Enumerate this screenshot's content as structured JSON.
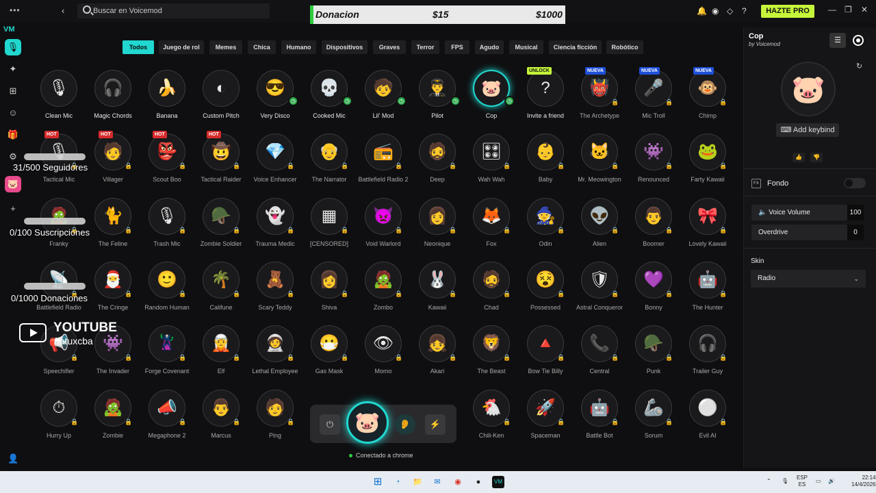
{
  "search": {
    "placeholder": "Buscar en Voicemod"
  },
  "donation": {
    "label": "Donacion",
    "current": "$15",
    "goal": "$1000"
  },
  "header": {
    "upgrade_label": "HAZTE PRO"
  },
  "categories": [
    "Todos",
    "Juego de rol",
    "Memes",
    "Chica",
    "Humano",
    "Dispositivos",
    "Graves",
    "Terror",
    "FPS",
    "Agudo",
    "Musical",
    "Ciencia ficción",
    "Robótico"
  ],
  "voices": [
    {
      "name": "Clean Mic",
      "icon": "🎙",
      "free": true,
      "badge": ""
    },
    {
      "name": "Magic Chords",
      "icon": "🎧",
      "free": true,
      "badge": ""
    },
    {
      "name": "Banana",
      "icon": "🍌",
      "free": true,
      "badge": ""
    },
    {
      "name": "Custom Pitch",
      "icon": "◐",
      "free": true,
      "badge": ""
    },
    {
      "name": "Very Disco",
      "icon": "😎",
      "free": true,
      "badge": "",
      "clock": true
    },
    {
      "name": "Cooked Mic",
      "icon": "💀",
      "free": true,
      "badge": "",
      "clock": true
    },
    {
      "name": "Lil' Mod",
      "icon": "🧒",
      "free": true,
      "badge": "",
      "clock": true
    },
    {
      "name": "Pilot",
      "icon": "👨‍✈️",
      "free": true,
      "badge": "",
      "clock": true
    },
    {
      "name": "Cop",
      "icon": "🐷",
      "free": true,
      "badge": "",
      "clock": true,
      "selected": true
    },
    {
      "name": "Invite a friend",
      "icon": "?",
      "free": true,
      "badge": "UNLOCK"
    },
    {
      "name": "The Archetype",
      "icon": "👹",
      "badge": "NUEVA"
    },
    {
      "name": "Mic Troll",
      "icon": "🎤",
      "badge": "NUEVA"
    },
    {
      "name": "Chimp",
      "icon": "🐵",
      "badge": "NUEVA"
    },
    {
      "name": "Tactical Mic",
      "icon": "🎙",
      "badge": "HOT"
    },
    {
      "name": "Villager",
      "icon": "🧑",
      "badge": "HOT"
    },
    {
      "name": "Scout Boo",
      "icon": "👺",
      "badge": "HOT"
    },
    {
      "name": "Tactical Raider",
      "icon": "🤠",
      "badge": "HOT"
    },
    {
      "name": "Voice Enhancer",
      "icon": "💎",
      "badge": ""
    },
    {
      "name": "The Narrator",
      "icon": "👴",
      "badge": ""
    },
    {
      "name": "Battlefield Radio 2",
      "icon": "📻",
      "badge": ""
    },
    {
      "name": "Deep",
      "icon": "🧔",
      "badge": ""
    },
    {
      "name": "Wah Wah",
      "icon": "🎛",
      "badge": ""
    },
    {
      "name": "Baby",
      "icon": "👶",
      "badge": ""
    },
    {
      "name": "Mr. Meowington",
      "icon": "🐱",
      "badge": ""
    },
    {
      "name": "Renounced",
      "icon": "👾",
      "badge": ""
    },
    {
      "name": "Farty Kawaii",
      "icon": "🐸",
      "badge": ""
    },
    {
      "name": "Franky",
      "icon": "🧟",
      "badge": ""
    },
    {
      "name": "The Feline",
      "icon": "🐈",
      "badge": ""
    },
    {
      "name": "Trash Mic",
      "icon": "🎙",
      "badge": ""
    },
    {
      "name": "Zombie Soldier",
      "icon": "🪖",
      "badge": ""
    },
    {
      "name": "Trauma Medic",
      "icon": "👻",
      "badge": ""
    },
    {
      "name": "[CENSORED]",
      "icon": "▦",
      "badge": ""
    },
    {
      "name": "Void Warlord",
      "icon": "👿",
      "badge": ""
    },
    {
      "name": "Neonique",
      "icon": "👩",
      "badge": ""
    },
    {
      "name": "Fox",
      "icon": "🦊",
      "badge": ""
    },
    {
      "name": "Odin",
      "icon": "🧙",
      "badge": ""
    },
    {
      "name": "Alien",
      "icon": "👽",
      "badge": ""
    },
    {
      "name": "Boomer",
      "icon": "👨",
      "badge": ""
    },
    {
      "name": "Lovely Kawaii",
      "icon": "🎀",
      "badge": ""
    },
    {
      "name": "Battlefield Radio",
      "icon": "📡",
      "badge": ""
    },
    {
      "name": "The Cringe",
      "icon": "🎅",
      "badge": ""
    },
    {
      "name": "Random Human",
      "icon": "🙂",
      "badge": ""
    },
    {
      "name": "Califune",
      "icon": "🌴",
      "badge": ""
    },
    {
      "name": "Scary Teddy",
      "icon": "🧸",
      "badge": ""
    },
    {
      "name": "Shiva",
      "icon": "👩",
      "badge": ""
    },
    {
      "name": "Zombo",
      "icon": "🧟",
      "badge": ""
    },
    {
      "name": "Kawaii",
      "icon": "🐰",
      "badge": ""
    },
    {
      "name": "Chad",
      "icon": "🧔",
      "badge": ""
    },
    {
      "name": "Possessed",
      "icon": "😵",
      "badge": ""
    },
    {
      "name": "Astral Conqueror",
      "icon": "🛡",
      "badge": ""
    },
    {
      "name": "Bonny",
      "icon": "💜",
      "badge": ""
    },
    {
      "name": "The Hunter",
      "icon": "🤖",
      "badge": ""
    },
    {
      "name": "Speechifier",
      "icon": "📢",
      "badge": ""
    },
    {
      "name": "The Invader",
      "icon": "👾",
      "badge": ""
    },
    {
      "name": "Forge Covenant",
      "icon": "🦹",
      "badge": ""
    },
    {
      "name": "Elf",
      "icon": "🧝",
      "badge": ""
    },
    {
      "name": "Lethal Employee",
      "icon": "🧑‍🚀",
      "badge": ""
    },
    {
      "name": "Gas Mask",
      "icon": "😷",
      "badge": ""
    },
    {
      "name": "Momo",
      "icon": "👁",
      "badge": ""
    },
    {
      "name": "Akari",
      "icon": "👧",
      "badge": ""
    },
    {
      "name": "The Beast",
      "icon": "🦁",
      "badge": ""
    },
    {
      "name": "Bow Tie Billy",
      "icon": "🔺",
      "badge": ""
    },
    {
      "name": "Central",
      "icon": "📞",
      "badge": ""
    },
    {
      "name": "Punk",
      "icon": "🪖",
      "badge": ""
    },
    {
      "name": "Trailer Guy",
      "icon": "🎧",
      "badge": ""
    },
    {
      "name": "Hurry Up",
      "icon": "⏱",
      "badge": ""
    },
    {
      "name": "Zombie",
      "icon": "🧟",
      "badge": ""
    },
    {
      "name": "Megaphone 2",
      "icon": "📣",
      "badge": ""
    },
    {
      "name": "Marcus",
      "icon": "👨",
      "badge": ""
    },
    {
      "name": "Ping",
      "icon": "🧑",
      "badge": ""
    },
    {
      "name": "",
      "icon": "",
      "badge": ""
    },
    {
      "name": "",
      "icon": "",
      "badge": ""
    },
    {
      "name": "",
      "icon": "",
      "badge": ""
    },
    {
      "name": "Chili-Ken",
      "icon": "🐔",
      "badge": ""
    },
    {
      "name": "Spaceman",
      "icon": "🚀",
      "badge": ""
    },
    {
      "name": "Battle Bot",
      "icon": "🤖",
      "badge": ""
    },
    {
      "name": "Sorum",
      "icon": "🦾",
      "badge": ""
    },
    {
      "name": "Evil AI",
      "icon": "⚪",
      "badge": ""
    }
  ],
  "panel": {
    "title": "Cop",
    "subtitle": "by Voicemod",
    "avatar_icon": "🐷",
    "keybind_label": "Add keybind",
    "fondo_label": "Fondo",
    "voice_volume_label": "Voice Volume",
    "voice_volume_value": "100",
    "overdrive_label": "Overdrive",
    "overdrive_value": "0",
    "skin_label": "Skin",
    "skin_value": "Radio"
  },
  "overlay": {
    "seguidores": "31/500 Seguidores",
    "suscripciones": "0/100 Suscripciones",
    "donaciones": "0/1000 Donaciones",
    "yt_title": "YOUTUBE",
    "yt_handle": "/tatuxcba"
  },
  "dock": {
    "status": "Conectado a chrome",
    "avatar_icon": "🐷"
  },
  "taskbar": {
    "lang1": "ESP",
    "lang2": "ES",
    "time": "22:14",
    "date": "14/4/2026"
  },
  "colors": {
    "accent": "#21d8d0",
    "pro": "#c6f63a",
    "nueva": "#1e4fd8",
    "hot": "#d62b2b"
  }
}
